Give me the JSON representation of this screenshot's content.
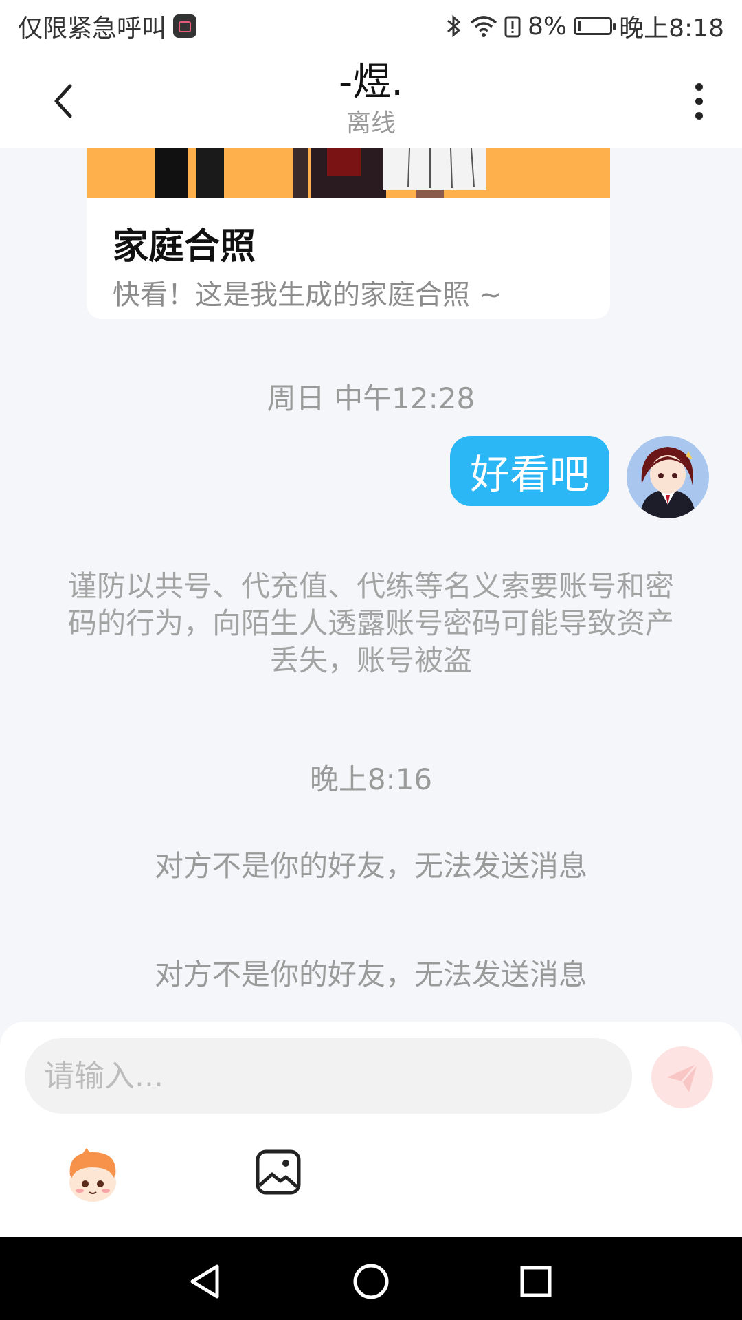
{
  "status_bar": {
    "left_text": "仅限紧急呼叫",
    "battery_percent": "8%",
    "time": "晚上8:18"
  },
  "header": {
    "title": "-煜.",
    "subtitle": "离线"
  },
  "card": {
    "title": "家庭合照",
    "description": "快看！这是我生成的家庭合照 ~"
  },
  "messages": {
    "time_1": "周日 中午12:28",
    "bubble_text": "好看吧",
    "notice_security": "谨防以共号、代充值、代练等名义索要账号和密码的行为，向陌生人透露账号密码可能导致资产丢失，账号被盗",
    "time_2": "晚上8:16",
    "notice_not_friend_1": "对方不是你的好友，无法发送消息",
    "notice_not_friend_2": "对方不是你的好友，无法发送消息"
  },
  "input": {
    "placeholder": "请输入..."
  },
  "colors": {
    "bubble": "#2bb6f5",
    "card_image": "#fdb04b",
    "send_button": "#fde3e2"
  },
  "icons": {
    "back": "back-arrow-icon",
    "more": "more-vertical-icon",
    "send": "send-icon",
    "emoji": "emoji-mascot-icon",
    "image": "image-icon"
  }
}
